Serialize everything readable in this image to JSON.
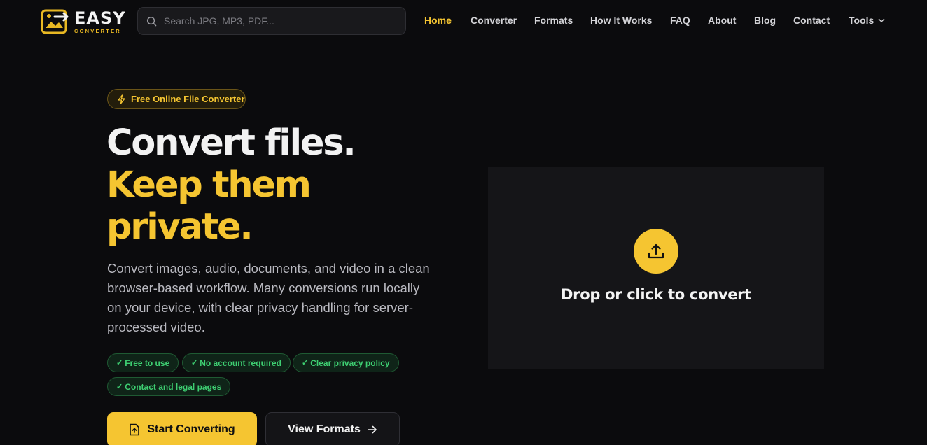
{
  "brand": {
    "word": "EASY",
    "sub": "CONVERTER"
  },
  "search": {
    "placeholder": "Search JPG, MP3, PDF..."
  },
  "nav": {
    "items": [
      {
        "label": "Home",
        "active": true
      },
      {
        "label": "Converter"
      },
      {
        "label": "Formats"
      },
      {
        "label": "How It Works"
      },
      {
        "label": "FAQ"
      },
      {
        "label": "About"
      },
      {
        "label": "Blog"
      },
      {
        "label": "Contact"
      },
      {
        "label": "Tools"
      }
    ]
  },
  "hero": {
    "badge": "Free Online File Converter",
    "title_line1": "Convert files.",
    "title_line2": "Keep them",
    "title_line3": "private.",
    "description": "Convert images, audio, documents, and video in a clean browser-based workflow. Many conversions run locally on your device, with clear privacy handling for server-processed video.",
    "features": [
      "Free to use",
      "No account required",
      "Clear privacy policy",
      "Contact and legal pages"
    ],
    "primary_button": "Start Converting",
    "secondary_button": "View Formats"
  },
  "dropzone": {
    "label": "Drop or click to convert"
  },
  "colors": {
    "accent": "#f5c531",
    "background": "#0b0b0d",
    "success": "#3ecf72",
    "panel": "#151518"
  }
}
